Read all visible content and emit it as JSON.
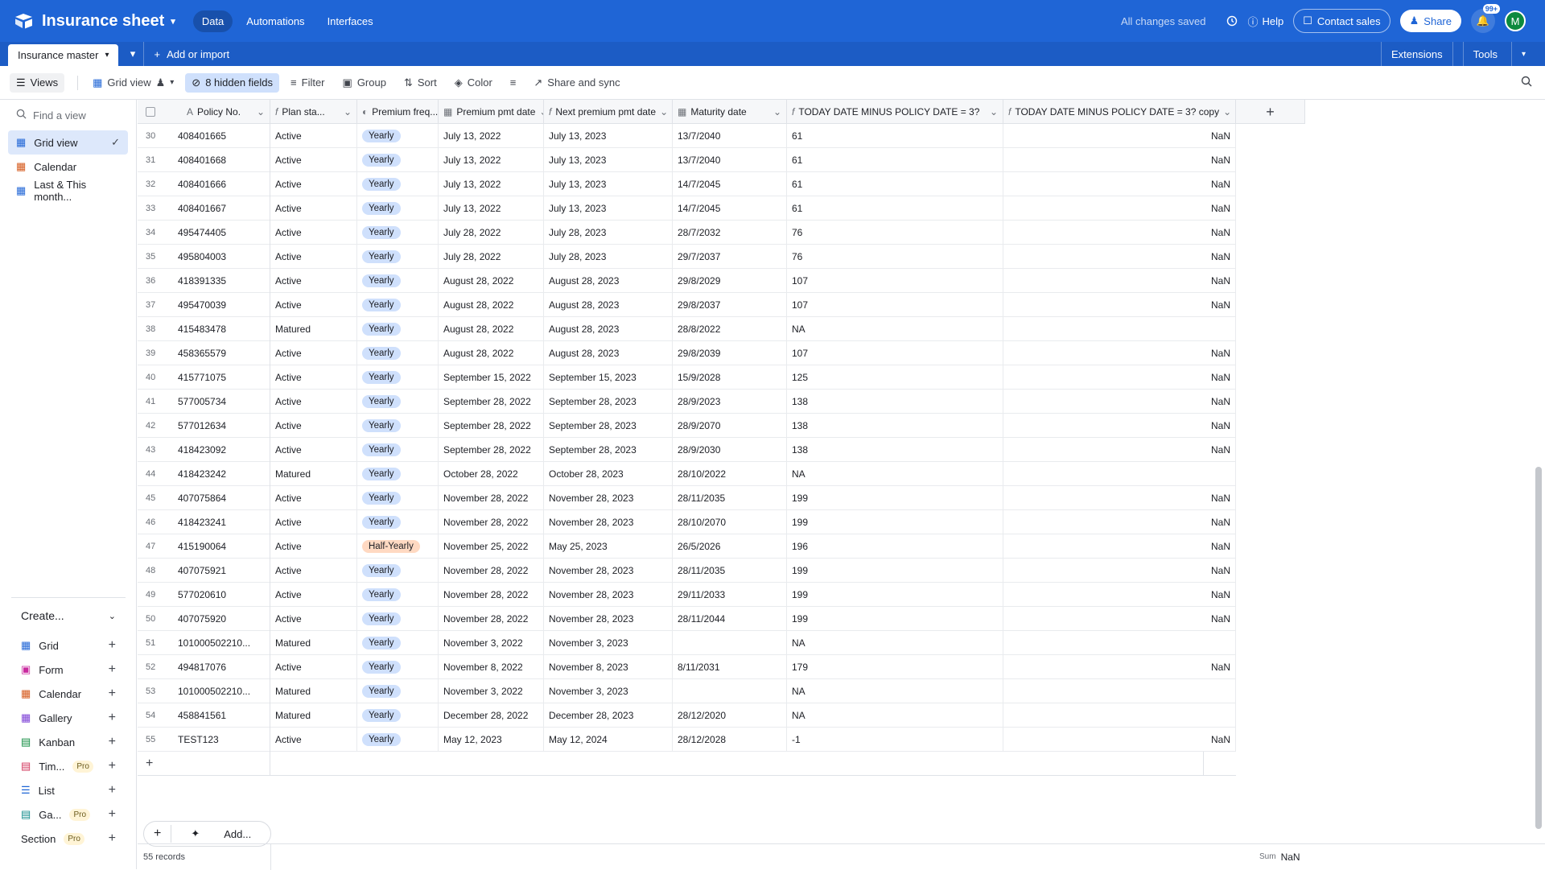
{
  "topbar": {
    "base_name": "Insurance sheet",
    "nav": [
      "Data",
      "Automations",
      "Interfaces"
    ],
    "saved": "All changes saved",
    "help": "Help",
    "contact": "Contact sales",
    "share": "Share",
    "notif_count": "99+",
    "avatar": "M",
    "brand_color": "#1f65d6"
  },
  "tablebar": {
    "table_name": "Insurance master",
    "add_import": "Add or import",
    "extensions": "Extensions",
    "tools": "Tools"
  },
  "viewbar": {
    "views": "Views",
    "grid_view": "Grid view",
    "hidden": "8 hidden fields",
    "filter": "Filter",
    "group": "Group",
    "sort": "Sort",
    "color": "Color",
    "share_sync": "Share and sync"
  },
  "sidebar": {
    "find_placeholder": "Find a view",
    "views": [
      {
        "label": "Grid view",
        "icon": "grid-icon"
      },
      {
        "label": "Calendar",
        "icon": "calendar-icon"
      },
      {
        "label": "Last & This month...",
        "icon": "grid-icon"
      }
    ],
    "create_label": "Create...",
    "create_items": [
      {
        "label": "Grid",
        "pro": ""
      },
      {
        "label": "Form",
        "pro": ""
      },
      {
        "label": "Calendar",
        "pro": ""
      },
      {
        "label": "Gallery",
        "pro": ""
      },
      {
        "label": "Kanban",
        "pro": ""
      },
      {
        "label": "Tim...",
        "pro": "Pro"
      },
      {
        "label": "List",
        "pro": ""
      },
      {
        "label": "Ga...",
        "pro": "Pro"
      },
      {
        "label": "Section",
        "pro": "Pro"
      }
    ]
  },
  "columns": [
    "Policy No.",
    "Plan sta...",
    "Premium freq...",
    "Premium pmt date",
    "Next premium pmt date",
    "Maturity date",
    "TODAY DATE MINUS POLICY DATE = 3?",
    "TODAY DATE MINUS POLICY DATE = 3? copy"
  ],
  "rows": [
    {
      "n": "30",
      "policy": "408401665",
      "status": "Active",
      "freq": "Yearly",
      "pmt": "July 13, 2022",
      "next": "July 13, 2023",
      "maturity": "13/7/2040",
      "diff": "61",
      "copy": "NaN"
    },
    {
      "n": "31",
      "policy": "408401668",
      "status": "Active",
      "freq": "Yearly",
      "pmt": "July 13, 2022",
      "next": "July 13, 2023",
      "maturity": "13/7/2040",
      "diff": "61",
      "copy": "NaN"
    },
    {
      "n": "32",
      "policy": "408401666",
      "status": "Active",
      "freq": "Yearly",
      "pmt": "July 13, 2022",
      "next": "July 13, 2023",
      "maturity": "14/7/2045",
      "diff": "61",
      "copy": "NaN"
    },
    {
      "n": "33",
      "policy": "408401667",
      "status": "Active",
      "freq": "Yearly",
      "pmt": "July 13, 2022",
      "next": "July 13, 2023",
      "maturity": "14/7/2045",
      "diff": "61",
      "copy": "NaN"
    },
    {
      "n": "34",
      "policy": "495474405",
      "status": "Active",
      "freq": "Yearly",
      "pmt": "July 28, 2022",
      "next": "July 28, 2023",
      "maturity": "28/7/2032",
      "diff": "76",
      "copy": "NaN"
    },
    {
      "n": "35",
      "policy": "495804003",
      "status": "Active",
      "freq": "Yearly",
      "pmt": "July 28, 2022",
      "next": "July 28, 2023",
      "maturity": "29/7/2037",
      "diff": "76",
      "copy": "NaN"
    },
    {
      "n": "36",
      "policy": "418391335",
      "status": "Active",
      "freq": "Yearly",
      "pmt": "August 28, 2022",
      "next": "August 28, 2023",
      "maturity": "29/8/2029",
      "diff": "107",
      "copy": "NaN"
    },
    {
      "n": "37",
      "policy": "495470039",
      "status": "Active",
      "freq": "Yearly",
      "pmt": "August 28, 2022",
      "next": "August 28, 2023",
      "maturity": "29/8/2037",
      "diff": "107",
      "copy": "NaN"
    },
    {
      "n": "38",
      "policy": "415483478",
      "status": "Matured",
      "freq": "Yearly",
      "pmt": "August 28, 2022",
      "next": "August 28, 2023",
      "maturity": "28/8/2022",
      "diff": "NA",
      "copy": ""
    },
    {
      "n": "39",
      "policy": "458365579",
      "status": "Active",
      "freq": "Yearly",
      "pmt": "August 28, 2022",
      "next": "August 28, 2023",
      "maturity": "29/8/2039",
      "diff": "107",
      "copy": "NaN"
    },
    {
      "n": "40",
      "policy": "415771075",
      "status": "Active",
      "freq": "Yearly",
      "pmt": "September 15, 2022",
      "next": "September 15, 2023",
      "maturity": "15/9/2028",
      "diff": "125",
      "copy": "NaN"
    },
    {
      "n": "41",
      "policy": "577005734",
      "status": "Active",
      "freq": "Yearly",
      "pmt": "September 28, 2022",
      "next": "September 28, 2023",
      "maturity": "28/9/2023",
      "diff": "138",
      "copy": "NaN"
    },
    {
      "n": "42",
      "policy": "577012634",
      "status": "Active",
      "freq": "Yearly",
      "pmt": "September 28, 2022",
      "next": "September 28, 2023",
      "maturity": "28/9/2070",
      "diff": "138",
      "copy": "NaN"
    },
    {
      "n": "43",
      "policy": "418423092",
      "status": "Active",
      "freq": "Yearly",
      "pmt": "September 28, 2022",
      "next": "September 28, 2023",
      "maturity": "28/9/2030",
      "diff": "138",
      "copy": "NaN"
    },
    {
      "n": "44",
      "policy": "418423242",
      "status": "Matured",
      "freq": "Yearly",
      "pmt": "October 28, 2022",
      "next": "October 28, 2023",
      "maturity": "28/10/2022",
      "diff": "NA",
      "copy": ""
    },
    {
      "n": "45",
      "policy": "407075864",
      "status": "Active",
      "freq": "Yearly",
      "pmt": "November 28, 2022",
      "next": "November 28, 2023",
      "maturity": "28/11/2035",
      "diff": "199",
      "copy": "NaN"
    },
    {
      "n": "46",
      "policy": "418423241",
      "status": "Active",
      "freq": "Yearly",
      "pmt": "November 28, 2022",
      "next": "November 28, 2023",
      "maturity": "28/10/2070",
      "diff": "199",
      "copy": "NaN"
    },
    {
      "n": "47",
      "policy": "415190064",
      "status": "Active",
      "freq": "Half-Yearly",
      "pmt": "November 25, 2022",
      "next": "May 25, 2023",
      "maturity": "26/5/2026",
      "diff": "196",
      "copy": "NaN"
    },
    {
      "n": "48",
      "policy": "407075921",
      "status": "Active",
      "freq": "Yearly",
      "pmt": "November 28, 2022",
      "next": "November 28, 2023",
      "maturity": "28/11/2035",
      "diff": "199",
      "copy": "NaN"
    },
    {
      "n": "49",
      "policy": "577020610",
      "status": "Active",
      "freq": "Yearly",
      "pmt": "November 28, 2022",
      "next": "November 28, 2023",
      "maturity": "29/11/2033",
      "diff": "199",
      "copy": "NaN"
    },
    {
      "n": "50",
      "policy": "407075920",
      "status": "Active",
      "freq": "Yearly",
      "pmt": "November 28, 2022",
      "next": "November 28, 2023",
      "maturity": "28/11/2044",
      "diff": "199",
      "copy": "NaN"
    },
    {
      "n": "51",
      "policy": "101000502210...",
      "status": "Matured",
      "freq": "Yearly",
      "pmt": "November 3, 2022",
      "next": "November 3, 2023",
      "maturity": "",
      "diff": "NA",
      "copy": ""
    },
    {
      "n": "52",
      "policy": "494817076",
      "status": "Active",
      "freq": "Yearly",
      "pmt": "November 8, 2022",
      "next": "November 8, 2023",
      "maturity": "8/11/2031",
      "diff": "179",
      "copy": "NaN"
    },
    {
      "n": "53",
      "policy": "101000502210...",
      "status": "Matured",
      "freq": "Yearly",
      "pmt": "November 3, 2022",
      "next": "November 3, 2023",
      "maturity": "",
      "diff": "NA",
      "copy": ""
    },
    {
      "n": "54",
      "policy": "458841561",
      "status": "Matured",
      "freq": "Yearly",
      "pmt": "December 28, 2022",
      "next": "December 28, 2023",
      "maturity": "28/12/2020",
      "diff": "NA",
      "copy": ""
    },
    {
      "n": "55",
      "policy": "TEST123",
      "status": "Active",
      "freq": "Yearly",
      "pmt": "May 12, 2023",
      "next": "May 12, 2024",
      "maturity": "28/12/2028",
      "diff": "-1",
      "copy": "NaN"
    }
  ],
  "footer": {
    "records": "55 records",
    "add_label": "Add...",
    "sum_label": "Sum",
    "sum_value": "NaN"
  }
}
